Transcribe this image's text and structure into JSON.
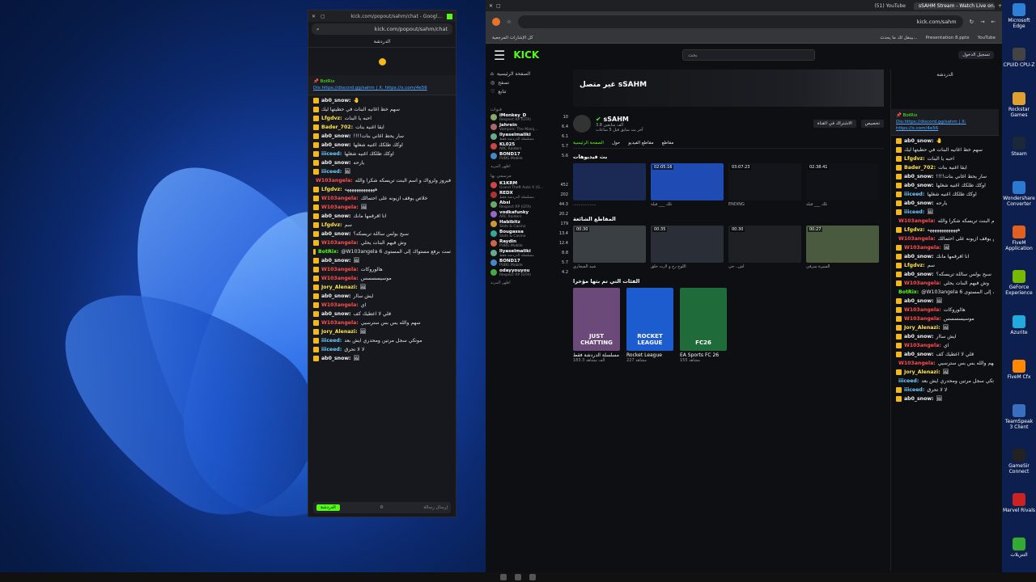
{
  "popout": {
    "title": "kick.com/popout/sahm/chat - Googl...",
    "url": "kick.com/popout/sahm/chat",
    "chat_header": "الدردشة",
    "pinned_text": "Dis:https://discord.gg/sahm | X: https://x.com/4e56",
    "pinned_by": "📌 BotRix",
    "messages": [
      {
        "user": "ab0_snow:",
        "text": "🤚",
        "color": "#f2f2f2"
      },
      {
        "user": "",
        "text": "سهم خط اغانيه البنات في حطيتها ليك",
        "color": "#f2f2f2"
      },
      {
        "user": "Lfgdvz:",
        "text": "احبه يا البنات",
        "color": "#ffe34d"
      },
      {
        "user": "Bader_702:",
        "text": "ايقا اغنية بنات",
        "color": "#ffe34d"
      },
      {
        "user": "ab0_snow:",
        "text": "!!!!سار يحط اغاني بنات",
        "color": "#f2f2f2"
      },
      {
        "user": "ab0_snow:",
        "text": "اوكك طلكك اغنيه شغلها",
        "color": "#f2f2f2"
      },
      {
        "user": "iiiceed:",
        "text": "اوكك طلكك اغنيه شغلها",
        "color": "#6ecbff"
      },
      {
        "user": "ab0_snow:",
        "text": "يارحه",
        "color": "#f2f2f2"
      },
      {
        "user": "iiiceed:",
        "text": "🖼",
        "color": "#6ecbff"
      },
      {
        "user": "W103angela:",
        "text": "فيروز ولرواك و اسم البنت تريسكه شكرا والله",
        "color": "#ff4d4d"
      },
      {
        "user": "Lfgdvz:",
        "text": "هههههههههههههه",
        "color": "#ffe34d"
      },
      {
        "user": "W103angela:",
        "text": "خلاص يوقف ازيونه على احتمالك",
        "color": "#ff4d4d"
      },
      {
        "user": "W103angela:",
        "text": "🖼",
        "color": "#ff4d4d"
      },
      {
        "user": "ab0_snow:",
        "text": "انا اقرقمها مانك",
        "color": "#f2f2f2"
      },
      {
        "user": "Lfgdvz:",
        "text": "سم",
        "color": "#ffe34d"
      },
      {
        "user": "ab0_snow:",
        "text": "سبح بولس ساللة تريسكه؟",
        "color": "#f2f2f2"
      },
      {
        "user": "W103angela:",
        "text": "وش فيهم البنات يحلي",
        "color": "#ff4d4d"
      },
      {
        "user": "BotRix:",
        "text": "@W103angela تمت برفع مستواك إلى المستوى 6",
        "color": "#53fc18"
      },
      {
        "user": "ab0_snow:",
        "text": "🖼",
        "color": "#f2f2f2"
      },
      {
        "user": "W103angela:",
        "text": "هالوروكات",
        "color": "#ff4d4d"
      },
      {
        "user": "W103angela:",
        "text": "موسيسسسس",
        "color": "#ff4d4d"
      },
      {
        "user": "Jory_Alenazi:",
        "text": "🖼",
        "color": "#ffe34d"
      },
      {
        "user": "ab0_snow:",
        "text": "ايش ساار",
        "color": "#f2f2f2"
      },
      {
        "user": "W103angela:",
        "text": "اي",
        "color": "#ff4d4d"
      },
      {
        "user": "ab0_snow:",
        "text": "قلي لا اعطيك كف",
        "color": "#f2f2f2"
      },
      {
        "user": "W103angela:",
        "text": "سهم والله يس بس سترسيي",
        "color": "#ff4d4d"
      },
      {
        "user": "Jory_Alenazi:",
        "text": "🖼",
        "color": "#ffe34d"
      },
      {
        "user": "iiiceed:",
        "text": "موتكي سجل مرتين ومحدري ايش بعد",
        "color": "#6ecbff"
      },
      {
        "user": "iiiceed:",
        "text": "لا لا تحرق",
        "color": "#6ecbff"
      },
      {
        "user": "ab0_snow:",
        "text": "🖼",
        "color": "#f2f2f2"
      }
    ],
    "input_placeholder": "إرسال رسالة",
    "send_label": "الدردشة"
  },
  "browser": {
    "tabs": [
      "sSAHM Stream - Watch Live on...",
      "(51) YouTube"
    ],
    "url": "kick.com/sahm",
    "bookmarks": [
      "كل الإشارات المرجعية",
      "بينقل لك ما يحدث...",
      "Presentation 8.pptx",
      "YouTube"
    ],
    "logo": "KICK",
    "search_placeholder": "بحث",
    "login_label": "تسجيل الدخول"
  },
  "sidebar": {
    "home": "الصفحة الرئيسية",
    "browse": "تصفح",
    "following": "تتابع",
    "recommended_title": "قنوات",
    "channels": [
      {
        "name": "iMonkey_D",
        "game": "Respect RP (GTA)",
        "viewers": "10",
        "color": "#8a6"
      },
      {
        "name": "Jahrein",
        "game": "Vampire: The Masq...",
        "viewers": "6.4",
        "color": "#a66"
      },
      {
        "name": "llyaselmaliki",
        "game": "مسلسلة الدردشة فقط",
        "viewers": "6.1",
        "color": "#6a8"
      },
      {
        "name": "KL025",
        "game": "ARC Raiders",
        "viewers": "5.7",
        "color": "#c44"
      },
      {
        "name": "BOND17",
        "game": "PUBG Mobile",
        "viewers": "5.6",
        "color": "#48c"
      }
    ],
    "show_more": "اظهر المزيد",
    "popular_title": "مرسمي بها",
    "popular": [
      {
        "name": "K1KRM",
        "game": "Grand Theft Auto V (G...",
        "viewers": "452",
        "color": "#c44"
      },
      {
        "name": "REDX",
        "game": "مسلسلة الدردشة فقط",
        "viewers": "202",
        "color": "#a33"
      },
      {
        "name": "Absi",
        "game": "Respect RP (GTA)",
        "viewers": "44.3",
        "color": "#6a6"
      },
      {
        "name": "vodkafunky",
        "game": "ARC Raiders",
        "viewers": "20.2",
        "color": "#96c"
      },
      {
        "name": "Habibitz",
        "game": "Slots & Casino",
        "viewers": "179",
        "color": "#c93"
      },
      {
        "name": "Bougassa",
        "game": "Slots & Casino",
        "viewers": "13.4",
        "color": "#3a9"
      },
      {
        "name": "Raydin",
        "game": "PUBG Mobile",
        "viewers": "12.4",
        "color": "#c64"
      },
      {
        "name": "llyaselmaliki",
        "game": "مسلسلة الدردشة فقط",
        "viewers": "8.8",
        "color": "#6a8"
      },
      {
        "name": "BOND17",
        "game": "PUBG Mobile",
        "viewers": "5.7",
        "color": "#48c"
      },
      {
        "name": "odayyouyou",
        "game": "Respect RP (GTA)",
        "viewers": "4.2",
        "color": "#4a4"
      }
    ]
  },
  "channel": {
    "offline_title": "غير متصل sSAHM",
    "name": "sSAHM",
    "followers": "3.8 ألف متابعين",
    "last_live": "آخر بث سابق قبل 5 ساعات",
    "follow_label": "الاشتراك في القناة",
    "subscribe_label": "تخصيص",
    "tabs": [
      "الصفحة الرئيسية",
      "حول",
      "مقاطع الفيديو",
      "مقاطع"
    ],
    "videos_title": "بث فيديوهات",
    "videos": [
      {
        "duration": "",
        "title": "..................",
        "color": "#1b2a55"
      },
      {
        "duration": "02:05:16",
        "title": "تلك ___ فيلة",
        "color": "#1f4bb5"
      },
      {
        "duration": "03:07:23",
        "title": "ENDING",
        "color": "#14151b"
      },
      {
        "duration": "02:38:41",
        "title": "تلك ___ فيلة",
        "color": "#101218"
      }
    ],
    "clips_title": "المقاطع الشائعة",
    "clips": [
      {
        "duration": "00:30",
        "title": "شيد السجاري",
        "color": "#3a3f44"
      },
      {
        "duration": "00:35",
        "title": "اللوح زح و لارت خلق",
        "color": "#2a2e36"
      },
      {
        "duration": "00:30",
        "title": "اش.. حي",
        "color": "#1e2024"
      },
      {
        "duration": "00:27",
        "title": "السيرة سرفي",
        "color": "#4a5a3f"
      }
    ],
    "categories_title": "الفئات التي تم بثها مؤخرا",
    "categories": [
      {
        "name": "مسلسلة الدردشة فقط",
        "label": "JUST CHATTING",
        "viewers": "183.3 ألف مشاهد",
        "color": "#6b4a7a"
      },
      {
        "name": "Rocket League",
        "label": "ROCKET LEAGUE",
        "viewers": "227 مشاهد",
        "color": "#1d5ccf"
      },
      {
        "name": "EA Sports FC 26",
        "label": "FC26",
        "viewers": "155 مشاهد",
        "color": "#1f6b3a"
      }
    ]
  },
  "desktop_icons": [
    "Microsoft Edge",
    "CPUID CPU-Z",
    "Rockstar Games",
    "Steam",
    "Wondershare Converter",
    "FiveM Application",
    "GeForce Experience",
    "Azurite",
    "FiveM Cfx",
    "TeamSpeak 3 Client",
    "GameSir Connect",
    "Marvel Rivals",
    "التنزيلات"
  ]
}
